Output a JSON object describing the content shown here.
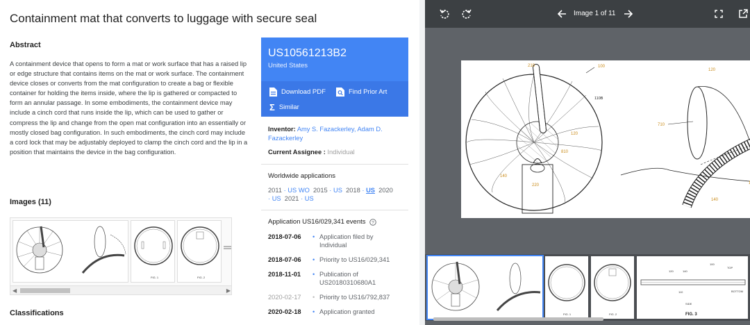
{
  "patent": {
    "title": "Containment mat that converts to luggage with secure seal",
    "abstract_heading": "Abstract",
    "abstract_text": "A containment device that opens to form a mat or work surface that has a raised lip or edge structure that contains items on the mat or work surface. The containment device closes or converts from the mat configuration to create a bag or flexible container for holding the items inside, where the lip is gathered or compacted to form an annular passage. In some embodiments, the containment device may include a cinch cord that runs inside the lip, which can be used to gather or compress the lip and change from the open mat configuration into an essentially or mostly closed bag configuration. In such embodiments, the cinch cord may include a cord lock that may be adjustably deployed to clamp the cinch cord and the lip in a position that maintains the device in the bag configuration.",
    "images_heading": "Images (11)",
    "classifications_heading": "Classifications"
  },
  "info": {
    "pub_number": "US10561213B2",
    "country": "United States",
    "download_pdf": "Download PDF",
    "find_prior_art": "Find Prior Art",
    "similar": "Similar",
    "inventor_label": "Inventor:",
    "inventor_value": "Amy S. Fazackerley, Adam D. Fazackerley",
    "assignee_label": "Current Assignee :",
    "assignee_value": "Individual",
    "ww_heading": "Worldwide applications",
    "ww": {
      "y2011": "2011",
      "us1": "US",
      "wo": "WO",
      "y2015": "2015",
      "us2": "US",
      "y2018": "2018",
      "us3": "US",
      "y2020": "2020",
      "us4": "US",
      "y2021": "2021",
      "us5": "US",
      "dot": "·"
    },
    "events_heading": "Application US16/029,341 events",
    "events": [
      {
        "date": "2018-07-06",
        "text": "Application filed by Individual",
        "muted": false
      },
      {
        "date": "2018-07-06",
        "text": "Priority to US16/029,341",
        "muted": false
      },
      {
        "date": "2018-11-01",
        "text": "Publication of US20180310680A1",
        "muted": false
      },
      {
        "date": "2020-02-17",
        "text": "Priority to US16/792,837",
        "muted": true
      },
      {
        "date": "2020-02-18",
        "text": "Application granted",
        "muted": false
      }
    ],
    "bullet": "•"
  },
  "viewer": {
    "counter": "Image 1 of 11",
    "icons": [
      "rotate-left-icon",
      "rotate-right-icon",
      "arrow-back-icon",
      "arrow-forward-icon",
      "fullscreen-icon",
      "open-in-new-icon"
    ]
  },
  "drawing_labels": {
    "main": [
      "210",
      "100",
      "110B",
      "120",
      "810",
      "140",
      "220",
      "710",
      "120",
      "110",
      "140"
    ],
    "fig1": "FIG. 1",
    "fig2": "FIG. 2",
    "fig3": "FIG. 3",
    "fig3_side": "SIDE",
    "fig3_top": "TOP",
    "fig3_bottom": "BOTTOM",
    "fig3_nums": [
      "120",
      "140",
      "100",
      "110"
    ]
  },
  "colors": {
    "brand_blue": "#4285f4",
    "viewer_bg": "#5f6368",
    "viewer_bar": "#3c4043",
    "label_orange": "#c98a17"
  }
}
